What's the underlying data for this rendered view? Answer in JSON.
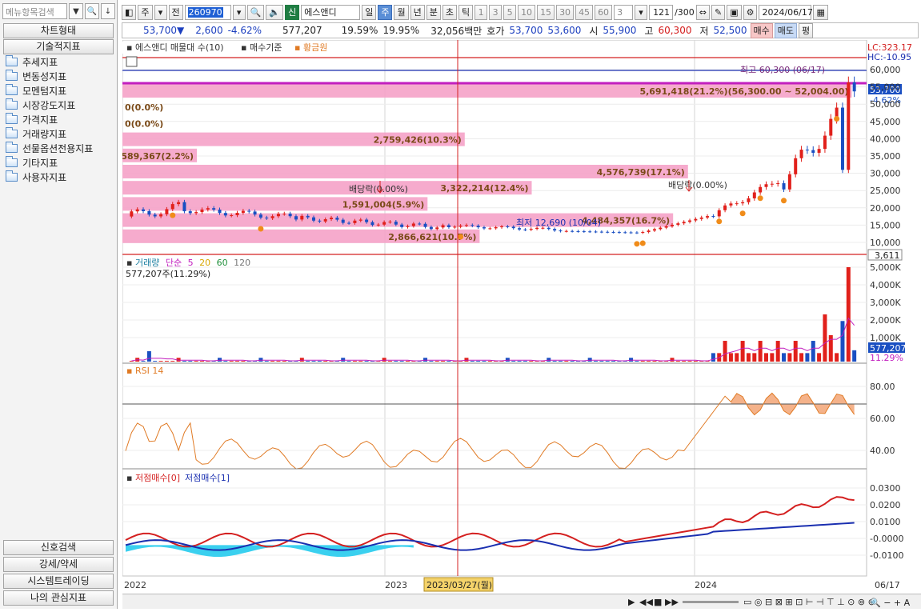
{
  "left": {
    "search_placeholder": "메뉴항목검색",
    "top_buttons": [
      "차트형태",
      "기술적지표"
    ],
    "tree": [
      "추세지표",
      "변동성지표",
      "모멘텀지표",
      "시장강도지표",
      "가격지표",
      "거래량지표",
      "선물옵션전용지표",
      "기타지표",
      "사용자지표"
    ],
    "bottom_buttons": [
      "신호검색",
      "강세/약세",
      "시스템트레이딩",
      "나의 관심지표"
    ]
  },
  "toolbar": {
    "period_sel": "주",
    "prev_label": "전",
    "code": "260970",
    "stock_tag": "신",
    "stock_name": "에스앤디",
    "intervals": [
      "일",
      "주",
      "월",
      "년",
      "분",
      "초",
      "틱"
    ],
    "active_interval": "주",
    "numbers": [
      "1",
      "3",
      "5",
      "10",
      "15",
      "30",
      "45",
      "60"
    ],
    "count_sel": "3",
    "range": "121",
    "range_total": "/300",
    "date": "2024/06/17"
  },
  "quote": {
    "price": "53,700",
    "arrow": "▼",
    "change": "2,600",
    "pct": "-4.62%",
    "volume": "577,207",
    "turnover1": "19.59%",
    "turnover2": "19.95%",
    "amount": "32,056백만",
    "ask_label": "호가",
    "ask1": "53,700",
    "ask2": "53,600",
    "open_label": "시",
    "open": "55,900",
    "high_label": "고",
    "high": "60,300",
    "low_label": "저",
    "low": "52,500",
    "buy": "매수",
    "sell": "매도",
    "flat": "평"
  },
  "price_panel": {
    "legend": [
      "에스앤디 매물대 수(10)",
      "매수기준",
      "황금원"
    ],
    "lc": "LC:323.17",
    "hc": "HC:-10.95",
    "y_labels": [
      "60,000",
      "55,000",
      "50,000",
      "45,000",
      "40,000",
      "35,000",
      "30,000",
      "25,000",
      "20,000",
      "15,000",
      "10,000"
    ],
    "current_price": "53,700",
    "current_pct": "-4.62%",
    "max_note": "최고 60,300 (06/17)",
    "min_note": "최저 12,690 (10/04)",
    "div_note": "배당락(0.00%)",
    "div_note2": "배당락(0.00%)",
    "profile": [
      {
        "label": "5,691,418(21.2%)(56,300.00 ~ 52,004.00)",
        "w": 0.98
      },
      {
        "label": "0(0.0%)",
        "w": 0
      },
      {
        "label": "0(0.0%)",
        "w": 0
      },
      {
        "label": "2,759,426(10.3%)",
        "w": 0.46
      },
      {
        "label": "589,367(2.2%)",
        "w": 0.1
      },
      {
        "label": "4,576,739(17.1%)",
        "w": 0.76
      },
      {
        "label": "3,322,214(12.4%)",
        "w": 0.55
      },
      {
        "label": "1,591,004(5.9%)",
        "w": 0.41
      },
      {
        "label": "4,484,357(16.7%)",
        "w": 0.74
      },
      {
        "label": "2,866,621(10.7%)",
        "w": 0.48
      }
    ]
  },
  "volume_panel": {
    "legend": [
      "거래량",
      "단순",
      "5",
      "20",
      "60",
      "120"
    ],
    "note": "577,207주(11.29%)",
    "y_labels": [
      "5,000K",
      "4,000K",
      "3,000K",
      "2,000K",
      "1,000K"
    ],
    "current": "577,207",
    "pct": "11.29%",
    "side_label": "3,611"
  },
  "rsi_panel": {
    "legend": "RSI 14",
    "y_labels": [
      "80.00",
      "60.00",
      "40.00"
    ]
  },
  "low_panel": {
    "legend": [
      "저점매수[0]",
      "저점매수[1]"
    ],
    "y_labels": [
      "0.0300",
      "0.0200",
      "0.0100",
      "-0.0000",
      "-0.0100"
    ]
  },
  "axis": {
    "years": [
      "2022",
      "2023",
      "2024"
    ],
    "cursor_date": "2023/03/27(월)",
    "last": "06/17"
  },
  "colors": {
    "up": "#e1201b",
    "down": "#1a4fc2",
    "profile": "#f5a2c8",
    "rsi": "#e07a24",
    "accent": "#5a8ed6"
  }
}
